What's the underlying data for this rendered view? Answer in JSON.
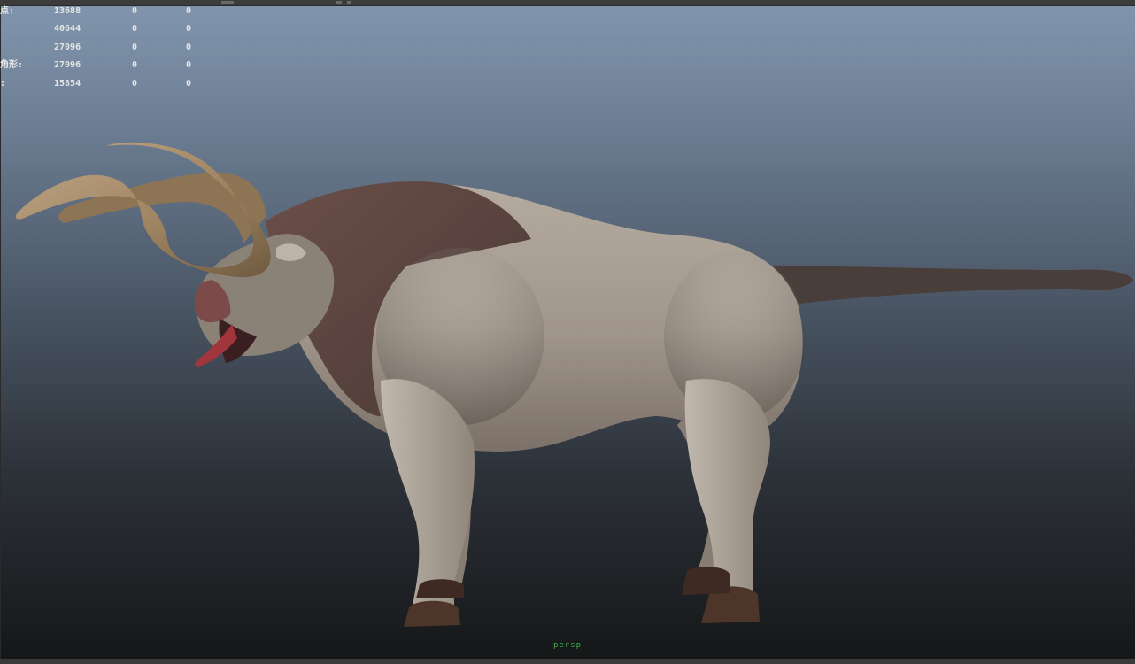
{
  "viewport": {
    "camera": "persp"
  },
  "hud_stats": [
    {
      "label": "点:",
      "values": [
        "13688",
        "0",
        "0"
      ]
    },
    {
      "label": "",
      "values": [
        "40644",
        "0",
        "0"
      ]
    },
    {
      "label": "",
      "values": [
        "27096",
        "0",
        "0"
      ]
    },
    {
      "label": "角形:",
      "values": [
        "27096",
        "0",
        "0"
      ]
    },
    {
      "label": ":",
      "values": [
        "15854",
        "0",
        "0"
      ]
    }
  ],
  "model": {
    "name": "horned-bull-creature-icon",
    "colors": {
      "skin": "#a39a8f",
      "fur": "#5b4440",
      "horn": "#9a8060",
      "hoof": "#4a3228",
      "tongue": "#a0353c"
    }
  }
}
